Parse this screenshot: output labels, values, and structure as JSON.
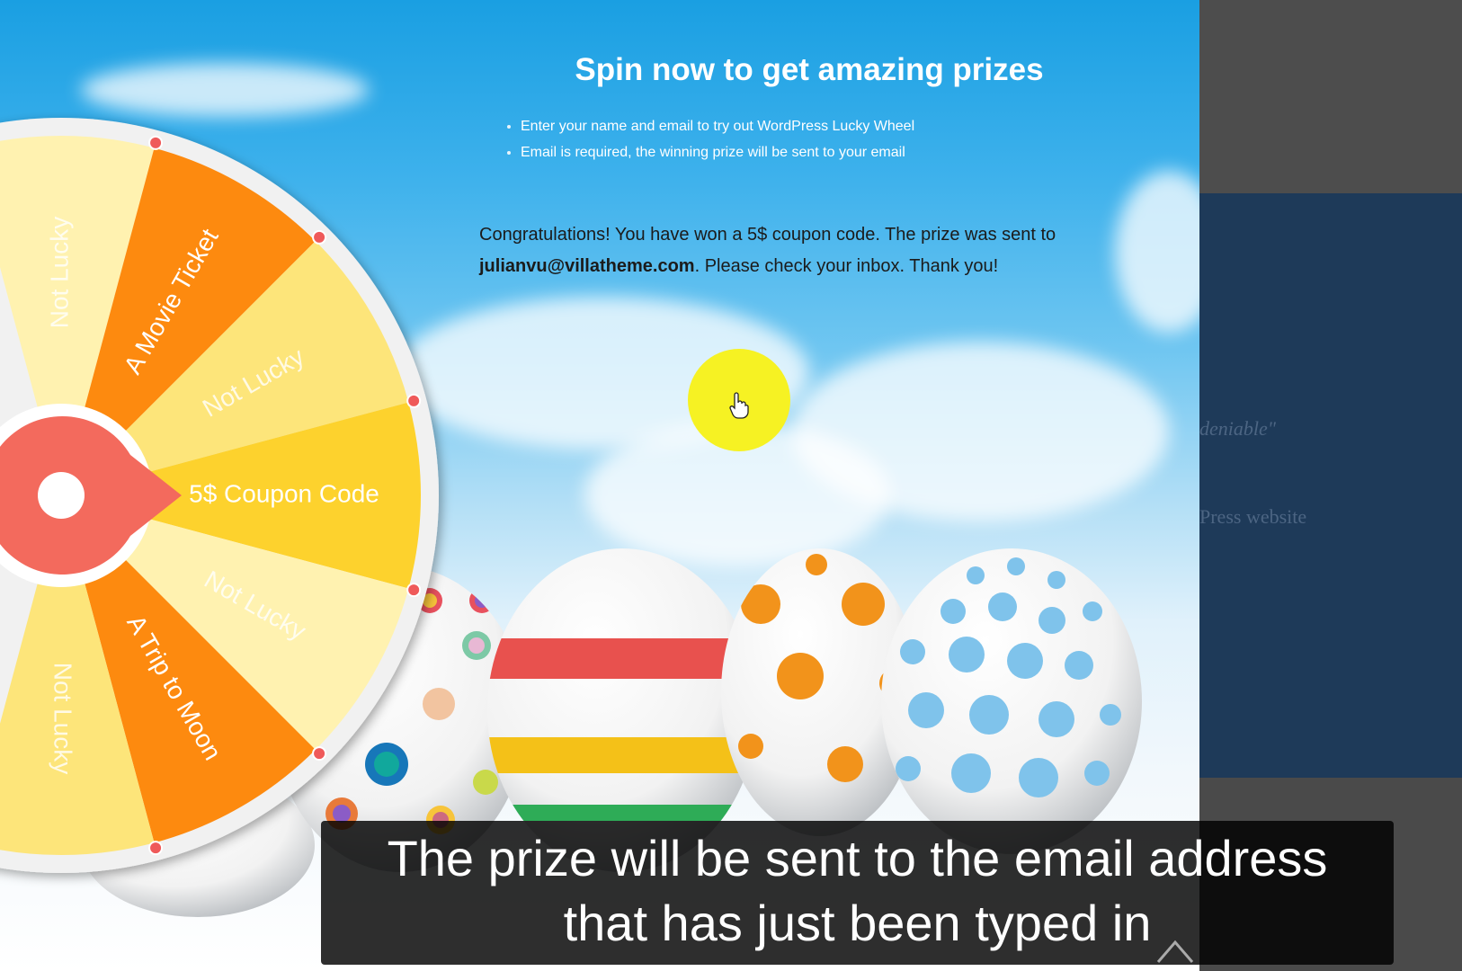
{
  "popup": {
    "title": "Spin now to get amazing prizes",
    "rules": [
      "Enter your name and email to try out WordPress Lucky Wheel",
      "Email is required, the winning prize will be sent to your email"
    ],
    "congrats_before": "Congratulations! You have won a 5$ coupon code. The prize was sent to",
    "email": "julianvu@villatheme.com",
    "congrats_after": ". Please check your inbox. Thank you!"
  },
  "wheel": {
    "slices": [
      {
        "label": "Not Lucky",
        "color": "#fff2b0"
      },
      {
        "label": "A Movie Ticket",
        "color": "#fd8a0f"
      },
      {
        "label": "Not Lucky",
        "color": "#fde57a"
      },
      {
        "label": "5$ Coupon Code",
        "color": "#fdd22d"
      },
      {
        "label": "Not Lucky",
        "color": "#fff2b0"
      },
      {
        "label": "A Trip to Moon",
        "color": "#fd8a0f"
      },
      {
        "label": "Not Lucky",
        "color": "#fde57a"
      }
    ],
    "pointer_color": "#f36a5d"
  },
  "background_page": {
    "quote_fragment": "deniable\"",
    "site_fragment": "Press website"
  },
  "subtitle": {
    "line1": "The prize will be sent to the email address",
    "line2": "that has just been typed in"
  },
  "colors": {
    "sky_top": "#1a9fe2",
    "sun": "#f6f223",
    "backdrop_panel": "#1e3a59"
  }
}
